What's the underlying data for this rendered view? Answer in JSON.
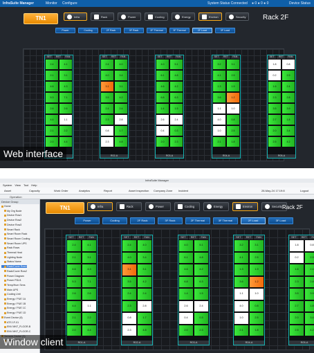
{
  "web": {
    "app_title": "InfraSuite Manager",
    "menu": [
      "Monitor",
      "Configure"
    ],
    "status_text": "System Status Connected",
    "indicators": "● 0 ● 0 ● 0",
    "user": "Device  Status",
    "caption": "Web interface"
  },
  "client": {
    "window_title": "InfraSuite Manager",
    "menu": [
      "System",
      "View",
      "Tool",
      "Help"
    ],
    "toolbar": [
      "Asset",
      "Capacity",
      "Work Order",
      "Analytics",
      "Report",
      "Asset Inspection",
      "Company Zone",
      "Incident"
    ],
    "datetime": "28-May-24 17:19:8",
    "logout": "Logout",
    "tabs": [
      "Operation",
      "Work..."
    ],
    "sidebar_header": "Device Group",
    "caption": "Window client",
    "tree": [
      "Home",
      "My Org Node",
      "Device Row1",
      "Device Row2",
      "Device Row3",
      "Smart Rack",
      "Smart Room Rack",
      "Smart Room Cooling",
      "Smart Room UPS",
      "Rack Rows",
      "Thermal Heat",
      "Lighting Node",
      "Status Name",
      "Rack/Cover Row1",
      "Rack/Cover Row2",
      "Power Diagram",
      "Power PDU1",
      "Temp/Hum Sens",
      "Main UPS",
      "Cooling Unit",
      "Energy / PUE 1A",
      "Energy / PUE 1B",
      "Energy / PUE 1C",
      "Energy / PUE 1D",
      "Event Device (8)",
      "ATS 1F-01",
      "ENV MNT_FLOOR-B",
      "ENV MNT_FLOOR-C",
      "Sensors Device (3)",
      "Sensor CH2"
    ]
  },
  "dashboard": {
    "room": "TN1",
    "rack_label": "Rack 2F",
    "tabs": [
      {
        "label": "Infra",
        "icon": "info-icon",
        "active": true
      },
      {
        "label": "Rack",
        "icon": "rack-icon",
        "active": false
      },
      {
        "label": "Power",
        "icon": "power-icon",
        "active": false
      },
      {
        "label": "Cooling",
        "icon": "cooling-icon",
        "active": false
      },
      {
        "label": "Energy",
        "icon": "energy-icon",
        "active": false
      },
      {
        "label": "Environ",
        "icon": "environment-icon",
        "active": true
      },
      {
        "label": "Security",
        "icon": "security-icon",
        "active": false
      }
    ],
    "subtabs": [
      "Power",
      "Cooling",
      "2F Rack",
      "3F Rack",
      "2F Thermal",
      "3F Thermal",
      "2F Load",
      "3F Load"
    ],
    "active_subtab": 6,
    "colors": {
      "ok": "#2fd22f",
      "warn": "#f07a1a",
      "accent": "#ffae1a",
      "rack_border": "#15b3b3"
    },
    "headers": [
      "SET",
      "RET",
      "FAN"
    ],
    "racks": [
      {
        "id": "R01-A",
        "values": [
          "2.4",
          "4.1",
          "2.1",
          "3.1",
          "4.6",
          "4.3",
          "5.3",
          "7.1",
          "2.6",
          "2.6",
          "4.4",
          "1.1",
          "2.1",
          "2.2",
          "2.0",
          "4.4"
        ],
        "states": "gggggggggggwgggg"
      },
      {
        "id": "R02-A",
        "values": [
          "2.4",
          "4.0",
          "4.0",
          "3.4",
          "3.1",
          "3.1",
          "3.5",
          "4.2",
          "2.4",
          "2.4",
          "2.3",
          "2.8",
          "0.8",
          "1.7",
          "2.3",
          "4.8"
        ],
        "states": "ggggoggggggwwgwg"
      },
      {
        "id": "R03-A",
        "values": [
          "4.0",
          "5.1",
          "6.1",
          "4.8",
          "4.6",
          "4.2",
          "6.8",
          "6.3",
          "1.4",
          "1.5",
          "2.6",
          "2.4",
          "0.4",
          "0.3",
          "2.0",
          "2.3"
        ],
        "states": "ggggggggggwwwggg"
      },
      {
        "id": "R04-A",
        "values": [
          "3.2",
          "3.1",
          "4.1",
          "2.5",
          "1.3",
          "1.9",
          "3.6",
          "1.2",
          "1.1",
          "1.0",
          "4.0",
          "0.8",
          "1.0",
          "2.5",
          "2.1",
          "1.8"
        ],
        "states": "gggggggowwwgwggg"
      },
      {
        "id": "R05-A",
        "values": [
          "1.8",
          "0.8",
          "0.2",
          "2.9",
          "1.6",
          "2.4",
          "2.3",
          "2.8",
          "3.5",
          "3.9",
          "2.7",
          "1.8",
          "2.0",
          "3.4",
          "2.5",
          "4.2"
        ],
        "states": "wwwggggggggggggg"
      }
    ]
  }
}
